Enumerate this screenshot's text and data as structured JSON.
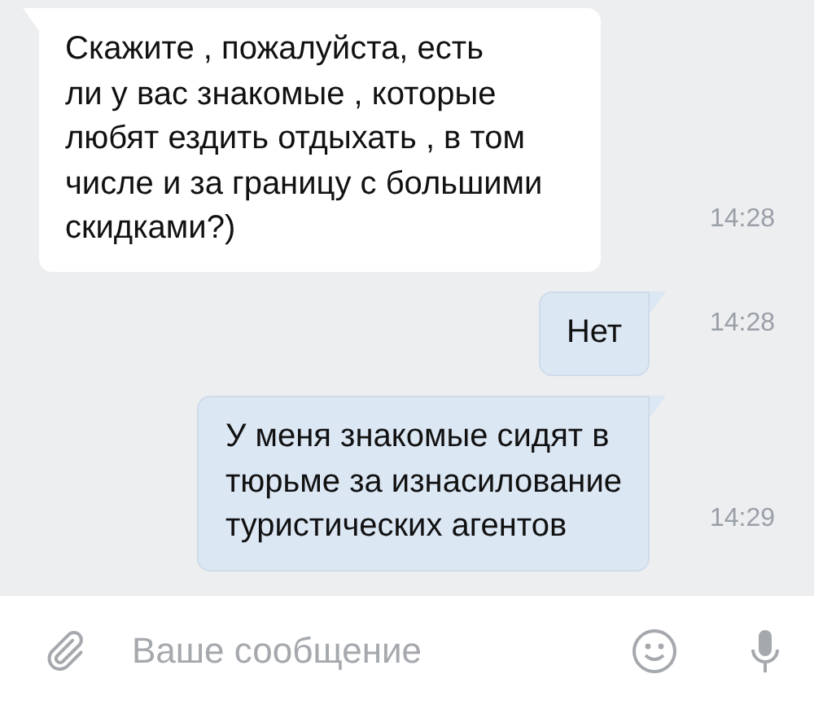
{
  "messages": [
    {
      "kind": "incoming",
      "text": "Скажите , пожалуйста, есть\nли у вас знакомые , которые\nлюбят ездить отдыхать , в том\nчисле и за границу с большими\nскидками?)",
      "time": "14:28"
    },
    {
      "kind": "outgoing",
      "text": "Нет",
      "time": "14:28"
    },
    {
      "kind": "outgoing",
      "text": "У меня знакомые сидят в\nтюрьме за изнасилование\nтуристических агентов",
      "time": "14:29"
    }
  ],
  "composer": {
    "placeholder": "Ваше сообщение"
  }
}
